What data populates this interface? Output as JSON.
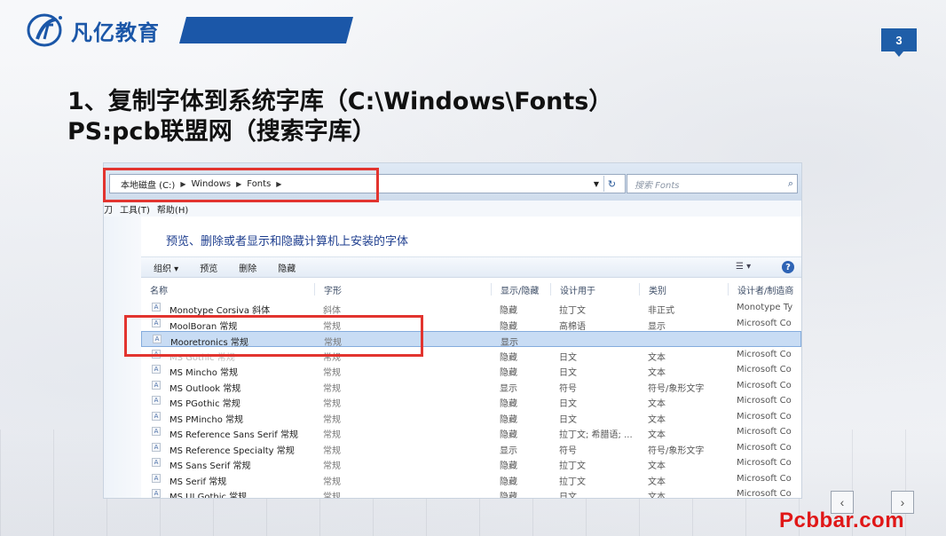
{
  "brand": {
    "name": "凡亿教育",
    "accent": "#1b57a8"
  },
  "page_number": "3",
  "title": {
    "line1": "1、复制字体到系统字库（C:\\Windows\\Fonts）",
    "line2": "PS:pcb联盟网（搜索字库）"
  },
  "explorer": {
    "address": [
      "本地磁盘 (C:)",
      "Windows",
      "Fonts"
    ],
    "search_placeholder": "搜索 Fonts",
    "menu": [
      "刀",
      "工具(T)",
      "帮助(H)"
    ],
    "heading": "预览、删除或者显示和隐藏计算机上安装的字体",
    "toolbar": {
      "organize": "组织 ▾",
      "preview": "预览",
      "delete": "删除",
      "hide": "隐藏"
    },
    "columns": [
      "名称",
      "字形",
      "显示/隐藏",
      "设计用于",
      "类别",
      "设计者/制造商"
    ],
    "rows": [
      {
        "name": "Monotype Corsiva 斜体",
        "style": "斜体",
        "show": "隐藏",
        "design": "拉丁文",
        "cat": "非正式",
        "maker": "Monotype Ty",
        "icon": "A"
      },
      {
        "name": "MoolBoran 常规",
        "style": "常规",
        "show": "隐藏",
        "design": "高棉语",
        "cat": "显示",
        "maker": "Microsoft Co",
        "icon": "A"
      },
      {
        "name": "Mooretronics 常规",
        "style": "常规",
        "show": "显示",
        "design": "",
        "cat": "",
        "maker": "",
        "icon": "A",
        "selected": true
      },
      {
        "name": "MS Gothic 常规",
        "style": "常规",
        "show": "隐藏",
        "design": "日文",
        "cat": "文本",
        "maker": "Microsoft Co",
        "icon": "A",
        "faded": true
      },
      {
        "name": "MS Mincho 常规",
        "style": "常规",
        "show": "隐藏",
        "design": "日文",
        "cat": "文本",
        "maker": "Microsoft Co",
        "icon": "A"
      },
      {
        "name": "MS Outlook 常规",
        "style": "常规",
        "show": "显示",
        "design": "符号",
        "cat": "符号/象形文字",
        "maker": "Microsoft Co",
        "icon": "A"
      },
      {
        "name": "MS PGothic 常规",
        "style": "常规",
        "show": "隐藏",
        "design": "日文",
        "cat": "文本",
        "maker": "Microsoft Co",
        "icon": "A"
      },
      {
        "name": "MS PMincho 常规",
        "style": "常规",
        "show": "隐藏",
        "design": "日文",
        "cat": "文本",
        "maker": "Microsoft Co",
        "icon": "A"
      },
      {
        "name": "MS Reference Sans Serif 常规",
        "style": "常规",
        "show": "隐藏",
        "design": "拉丁文; 希腊语; ...",
        "cat": "文本",
        "maker": "Microsoft Co",
        "icon": "A"
      },
      {
        "name": "MS Reference Specialty 常规",
        "style": "常规",
        "show": "显示",
        "design": "符号",
        "cat": "符号/象形文字",
        "maker": "Microsoft Co",
        "icon": "A"
      },
      {
        "name": "MS Sans Serif 常规",
        "style": "常规",
        "show": "隐藏",
        "design": "拉丁文",
        "cat": "文本",
        "maker": "Microsoft Co",
        "icon": "A"
      },
      {
        "name": "MS Serif 常规",
        "style": "常规",
        "show": "隐藏",
        "design": "拉丁文",
        "cat": "文本",
        "maker": "Microsoft Co",
        "icon": "A"
      },
      {
        "name": "MS UI Gothic 常规",
        "style": "常规",
        "show": "隐藏",
        "design": "日文",
        "cat": "文本",
        "maker": "Microsoft Co",
        "icon": "A"
      }
    ]
  },
  "highlight_color": "#e2342f",
  "nav": {
    "prev": "‹",
    "next": "›"
  },
  "watermark": "Pcbbar.com"
}
